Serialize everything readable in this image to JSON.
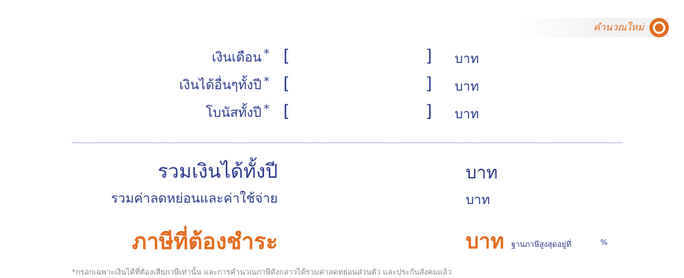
{
  "reset": {
    "label": "คำนวณใหม่",
    "icon": "target-refresh-icon"
  },
  "inputs": [
    {
      "label": "เงินเดือน",
      "required_mark": "*",
      "value": "",
      "unit": "บาท"
    },
    {
      "label": "เงินได้อื่นๆทั้งปี",
      "required_mark": "*",
      "value": "",
      "unit": "บาท"
    },
    {
      "label": "โบนัสทั้งปี",
      "required_mark": "*",
      "value": "",
      "unit": "บาท"
    }
  ],
  "results": {
    "total_income": {
      "label": "รวมเงินได้ทั้งปี",
      "value": "",
      "unit": "บาท"
    },
    "total_deduction": {
      "label": "รวมค่าลดหย่อนและค่าใช้จ่าย",
      "value": "",
      "unit": "บาท"
    },
    "tax": {
      "label": "ภาษีที่ต้องชำระ",
      "value": "",
      "unit": "บาท"
    },
    "top_rate": {
      "label": "ฐานภาษีสูงสุดอยู่ที่",
      "value": "",
      "unit": "%"
    }
  },
  "footnote": "*กรอกเฉพาะเงินได้ที่ต้องเสียภาษีเท่านั้น และการคำนวณภาษีดังกล่าวได้รวมค่าลดหย่อนส่วนตัว และประกันสังคมแล้ว",
  "colors": {
    "primary": "#2b3a8c",
    "accent": "#e36b1e",
    "muted": "#888888"
  }
}
